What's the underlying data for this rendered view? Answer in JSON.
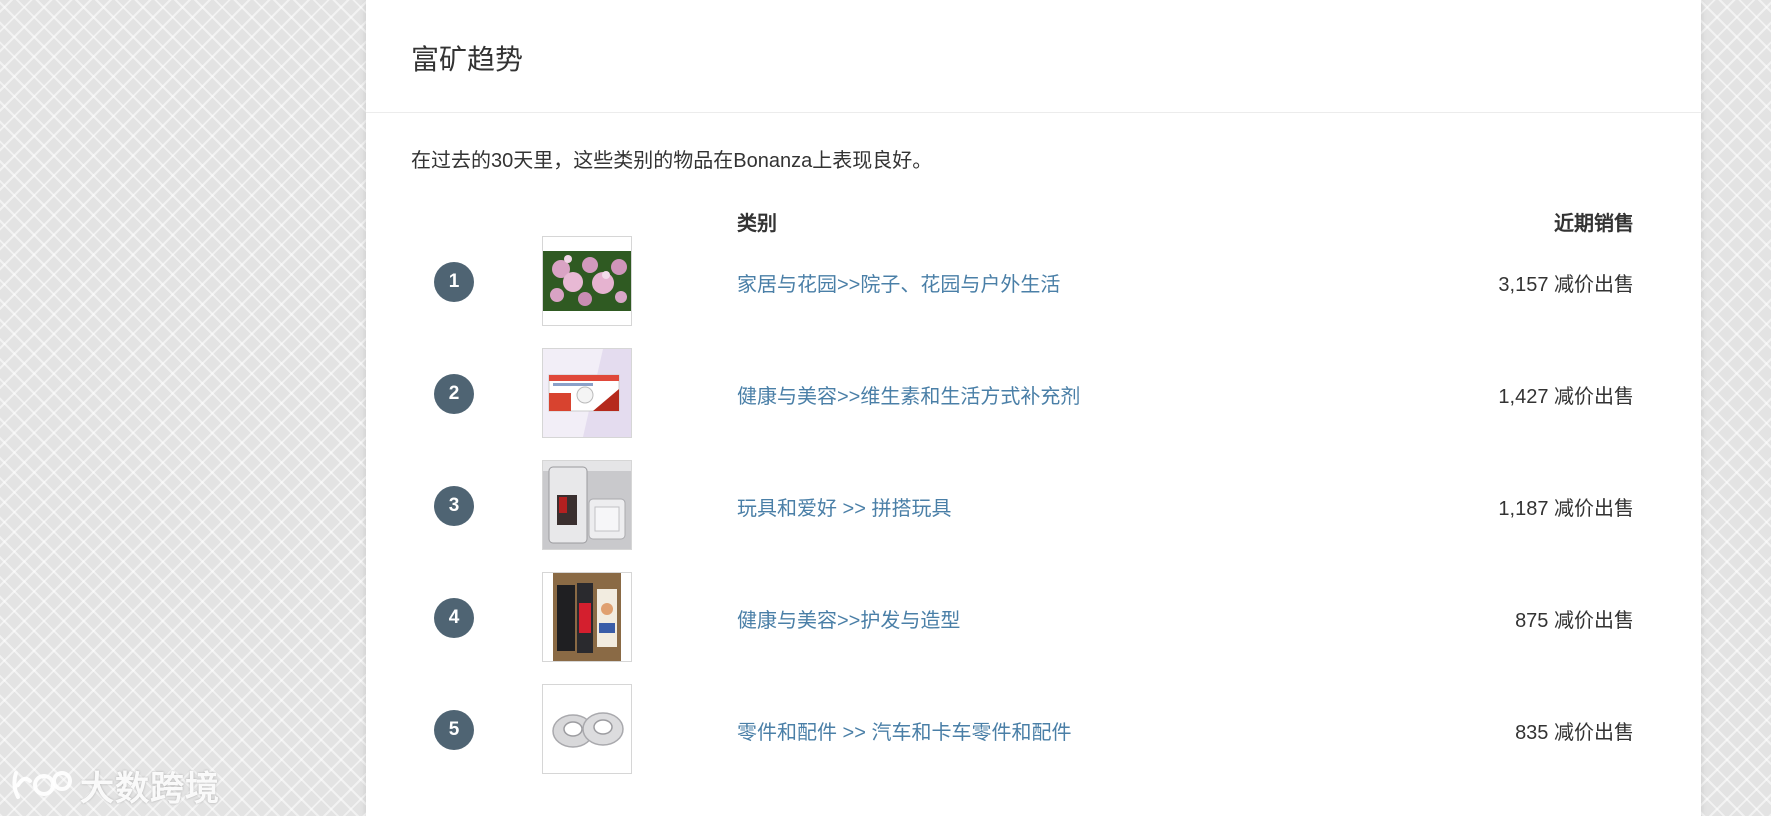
{
  "section": {
    "title": "富矿趋势",
    "intro": "在过去的30天里，这些类别的物品在Bonanza上表现良好。"
  },
  "table": {
    "headers": {
      "category": "类别",
      "recent_sales": "近期销售"
    },
    "rows": [
      {
        "rank": "1",
        "category": "家居与花园>>院子、花园与户外生活",
        "sales": "3,157 减价出售",
        "thumb": "pink-flowers"
      },
      {
        "rank": "2",
        "category": "健康与美容>>维生素和生活方式补充剂",
        "sales": "1,427 减价出售",
        "thumb": "supplement-box"
      },
      {
        "rank": "3",
        "category": "玩具和爱好 >> 拼搭玩具",
        "sales": "1,187 减价出售",
        "thumb": "toy-case"
      },
      {
        "rank": "4",
        "category": "健康与美容>>护发与造型",
        "sales": "875 减价出售",
        "thumb": "hair-products"
      },
      {
        "rank": "5",
        "category": "零件和配件 >> 汽车和卡车零件和配件",
        "sales": "835 减价出售",
        "thumb": "metal-parts"
      }
    ]
  },
  "watermark": {
    "text": "大数跨境"
  },
  "colors": {
    "link": "#4a7fa7",
    "rank_badge": "#4f6473",
    "text": "#333333"
  }
}
